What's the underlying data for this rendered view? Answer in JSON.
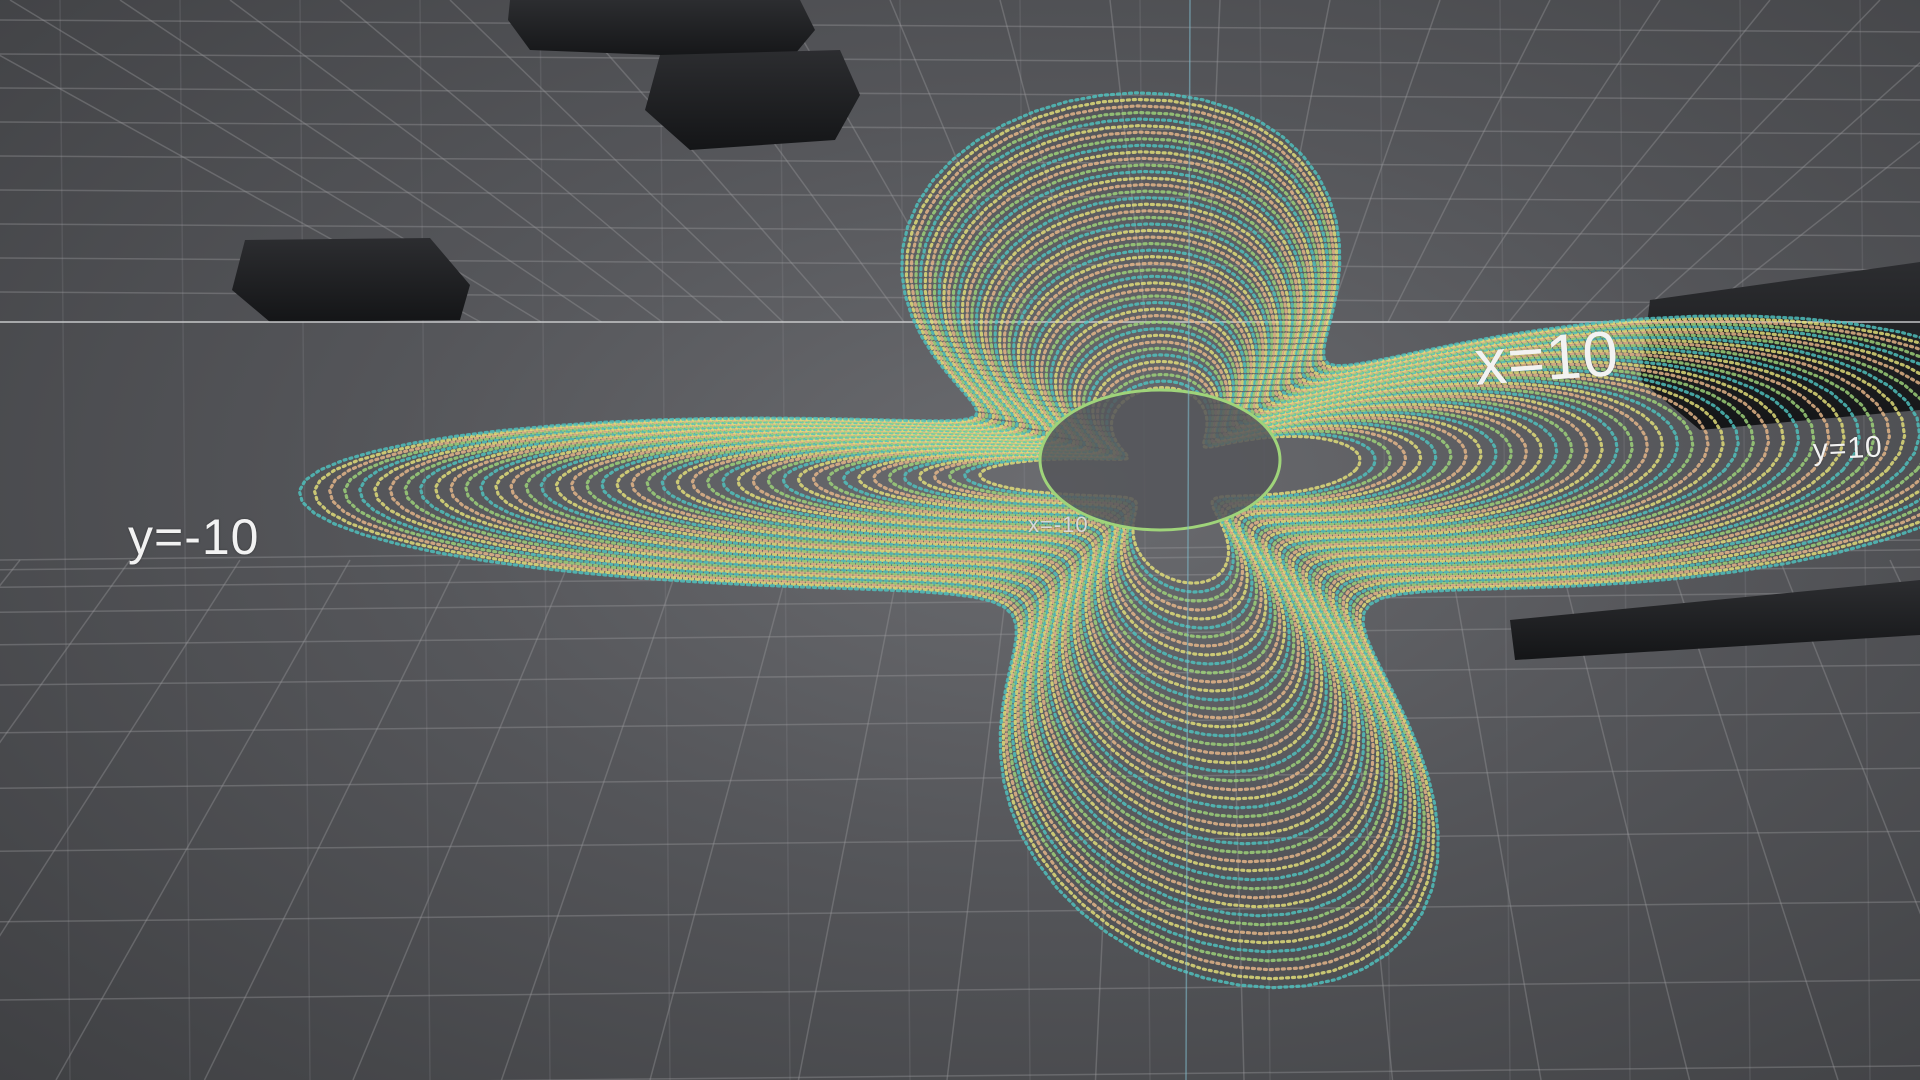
{
  "scene": {
    "axis_labels": {
      "y_negative": "y=-10",
      "x_positive": "x=10",
      "y_positive": "y=10",
      "x_negative": "x=-10"
    },
    "colors": {
      "background": "#4c4d50",
      "grid_line": "#9a9b9e",
      "surface_yellow": "#e4e07a",
      "surface_green": "#9fd47a",
      "surface_teal": "#4fc3c0",
      "surface_peach": "#e8b88a",
      "dark_panel": "#1f2022"
    }
  }
}
